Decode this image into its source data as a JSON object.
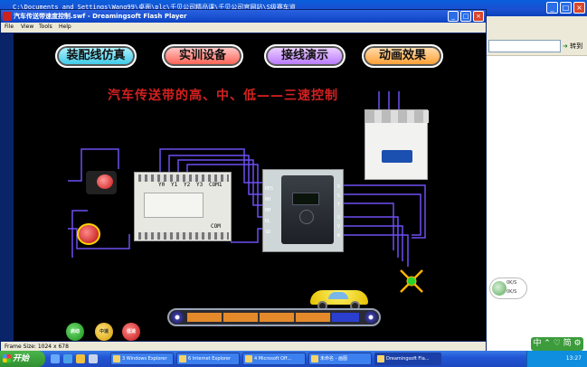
{
  "background_window": {
    "title": "C:\\Documents and Settings\\Wang99\\桌面\\plc\\千贝公司精品课\\千贝公司官网站\\S级赛车道",
    "go_label": "转到",
    "sticker_lines": [
      "0K/S",
      "0K/S"
    ]
  },
  "flash_window": {
    "title": "汽车传送带速度控制.swf - Dreamingsoft Flash Player",
    "menu": [
      "File",
      "View",
      "Tools",
      "Help"
    ],
    "status": "Frame Size: 1024 x 678"
  },
  "stage": {
    "nav_buttons": [
      "装配线仿真",
      "实训设备",
      "接线演示",
      "动画效果"
    ],
    "headline": "汽车传送带的高、中、低——三速控制",
    "plc_labels": [
      "Y0",
      "Y1",
      "Y2",
      "Y3",
      "COM1"
    ],
    "plc_bottom_label": "COM",
    "inverter_left_terminals": [
      "RES",
      "RH",
      "RM",
      "RL",
      "SD"
    ],
    "inverter_right_terminals": [
      "R",
      "S",
      "T",
      "U",
      "V",
      "W"
    ],
    "control_buttons": [
      "启动",
      "中速",
      "低速"
    ]
  },
  "ime": {
    "label": "中 ⌃ ♡ 简 ⚙"
  },
  "taskbar": {
    "start_label": "开始",
    "tasks": [
      "3 Windows Explorer",
      "6 Internet Explorer",
      "4 Microsoft Off...",
      "未命名 - 画图",
      "Dreamingsoft Fla..."
    ],
    "clock": "13:27"
  }
}
